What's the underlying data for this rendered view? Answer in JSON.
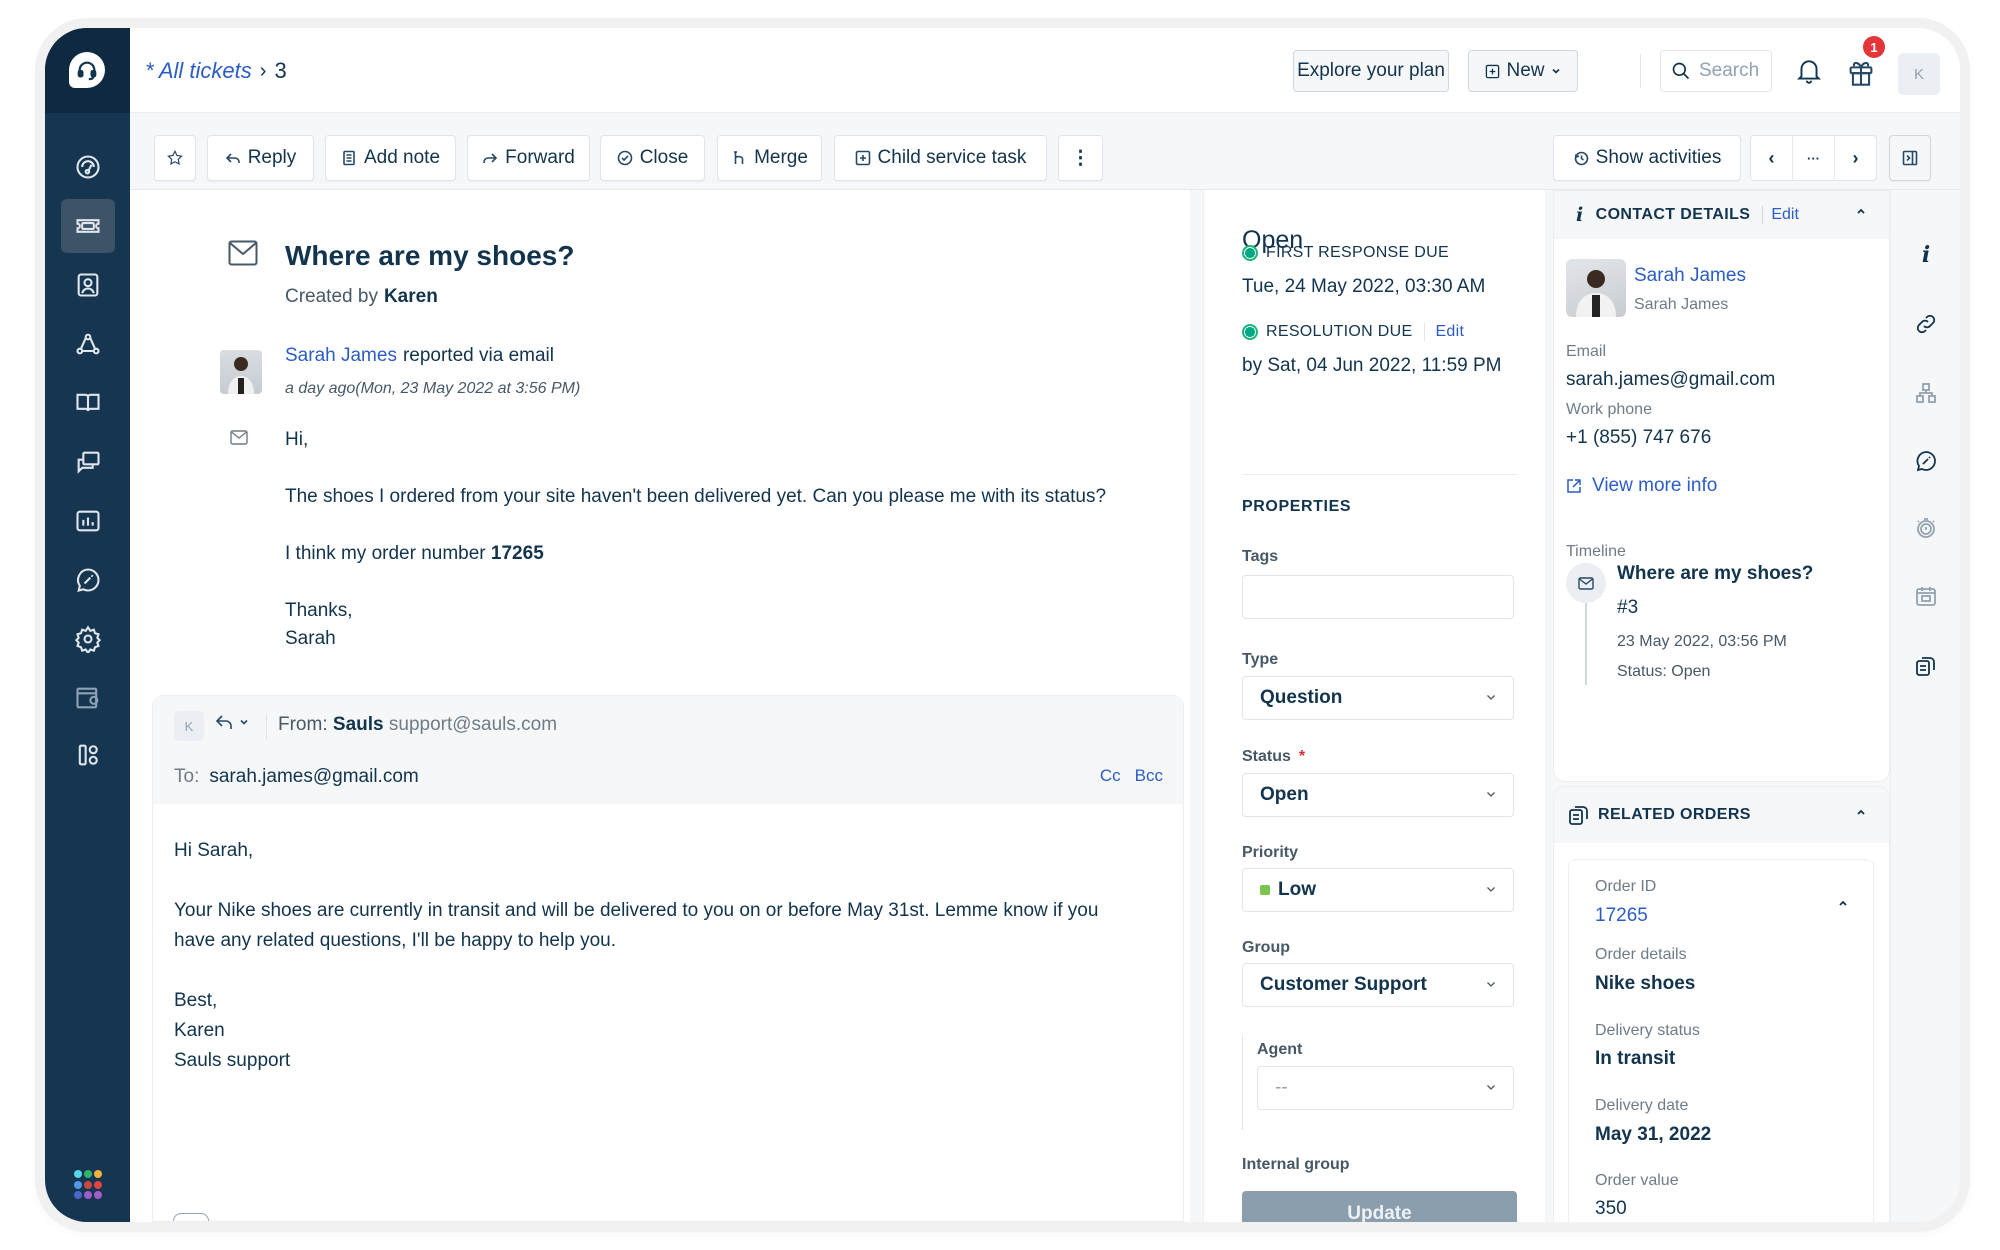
{
  "header": {
    "breadcrumb_link": "* All tickets",
    "breadcrumb_sep": "›",
    "breadcrumb_current": "3",
    "explore_plan_label": "Explore your plan",
    "new_label": "New",
    "search_placeholder": "Search",
    "notification_badge": "1",
    "user_initial": "K"
  },
  "sidebar": {
    "items": [
      {
        "name": "dashboard",
        "icon": "gauge-icon"
      },
      {
        "name": "tickets",
        "icon": "ticket-icon",
        "active": true
      },
      {
        "name": "contacts",
        "icon": "contact-icon"
      },
      {
        "name": "groups",
        "icon": "network-icon"
      },
      {
        "name": "knowledge-base",
        "icon": "book-icon"
      },
      {
        "name": "conversations",
        "icon": "chat-icon"
      },
      {
        "name": "reports",
        "icon": "chart-icon"
      },
      {
        "name": "admin-tools",
        "icon": "wrench-chat-icon"
      },
      {
        "name": "settings",
        "icon": "gear-icon"
      },
      {
        "name": "marketplace",
        "icon": "apps-store-icon"
      },
      {
        "name": "apps",
        "icon": "apps-grid-icon"
      }
    ],
    "app_switcher_colors": [
      "#5ad5e8",
      "#2cb56b",
      "#f3b13b",
      "#4d9be6",
      "#c9493e",
      "#e2443f",
      "#4a68c9",
      "#9b5fcb",
      "#a25fc9"
    ]
  },
  "toolbar": {
    "star_label": "",
    "reply_label": "Reply",
    "add_note_label": "Add note",
    "forward_label": "Forward",
    "close_label": "Close",
    "merge_label": "Merge",
    "child_task_label": "Child service task",
    "more_label": "⋮",
    "show_activities_label": "Show activities",
    "prev_label": "‹",
    "ellipsis_label": "···",
    "next_label": "›"
  },
  "ticket": {
    "title": "Where are my shoes?",
    "created_by_label": "Created by",
    "created_by": "Karen",
    "requester": "Sarah James",
    "reported_via": "reported via email",
    "timestamp": "a day ago(Mon, 23 May 2022 at 3:56 PM)",
    "message": {
      "greeting": "Hi,",
      "body": "The shoes I ordered from your site haven't been delivered yet. Can you please me with its status?",
      "order_prefix": "I think my order number",
      "order_number": "17265",
      "signoff": "Thanks,",
      "signature": "Sarah"
    }
  },
  "composer": {
    "agent_initial": "K",
    "from_label": "From:",
    "from_name": "Sauls",
    "from_address": "support@sauls.com",
    "to_label": "To:",
    "to_address": "sarah.james@gmail.com",
    "cc_label": "Cc",
    "bcc_label": "Bcc",
    "body": {
      "greeting": "Hi Sarah,",
      "paragraph": "Your Nike shoes are currently in transit and will be delivered to you on or before May 31st. Lemme know if you have any related questions, I'll be happy to help you.",
      "signoff": "Best,",
      "name": "Karen",
      "team": "Sauls support"
    }
  },
  "properties": {
    "status_title": "Open",
    "first_response_label": "FIRST RESPONSE DUE",
    "first_response_value": "Tue, 24 May 2022, 03:30 AM",
    "resolution_label": "RESOLUTION DUE",
    "resolution_edit": "Edit",
    "resolution_value": "by Sat, 04 Jun 2022, 11:59 PM",
    "section_title": "PROPERTIES",
    "tags_label": "Tags",
    "tags_value": "",
    "type_label": "Type",
    "type_value": "Question",
    "status_label": "Status",
    "status_required": "*",
    "status_value": "Open",
    "priority_label": "Priority",
    "priority_value": "Low",
    "priority_color": "#7bc54e",
    "group_label": "Group",
    "group_value": "Customer Support",
    "agent_label": "Agent",
    "agent_value": "--",
    "internal_group_label": "Internal group",
    "update_label": "Update"
  },
  "contact": {
    "section_title": "CONTACT DETAILS",
    "edit_label": "Edit",
    "name": "Sarah James",
    "subtitle": "Sarah James",
    "email_label": "Email",
    "email": "sarah.james@gmail.com",
    "phone_label": "Work phone",
    "phone": "+1 (855) 747 676",
    "view_more_label": "View more info",
    "timeline_label": "Timeline",
    "timeline": {
      "title": "Where are my shoes?",
      "id": "#3",
      "date": "23 May 2022, 03:56 PM",
      "status": "Status: Open"
    }
  },
  "orders": {
    "section_title": "RELATED ORDERS",
    "order_id_label": "Order ID",
    "order_id": "17265",
    "details_label": "Order details",
    "details": "Nike shoes",
    "delivery_status_label": "Delivery status",
    "delivery_status": "In transit",
    "delivery_date_label": "Delivery date",
    "delivery_date": "May 31, 2022",
    "value_label": "Order value",
    "value": "350"
  }
}
